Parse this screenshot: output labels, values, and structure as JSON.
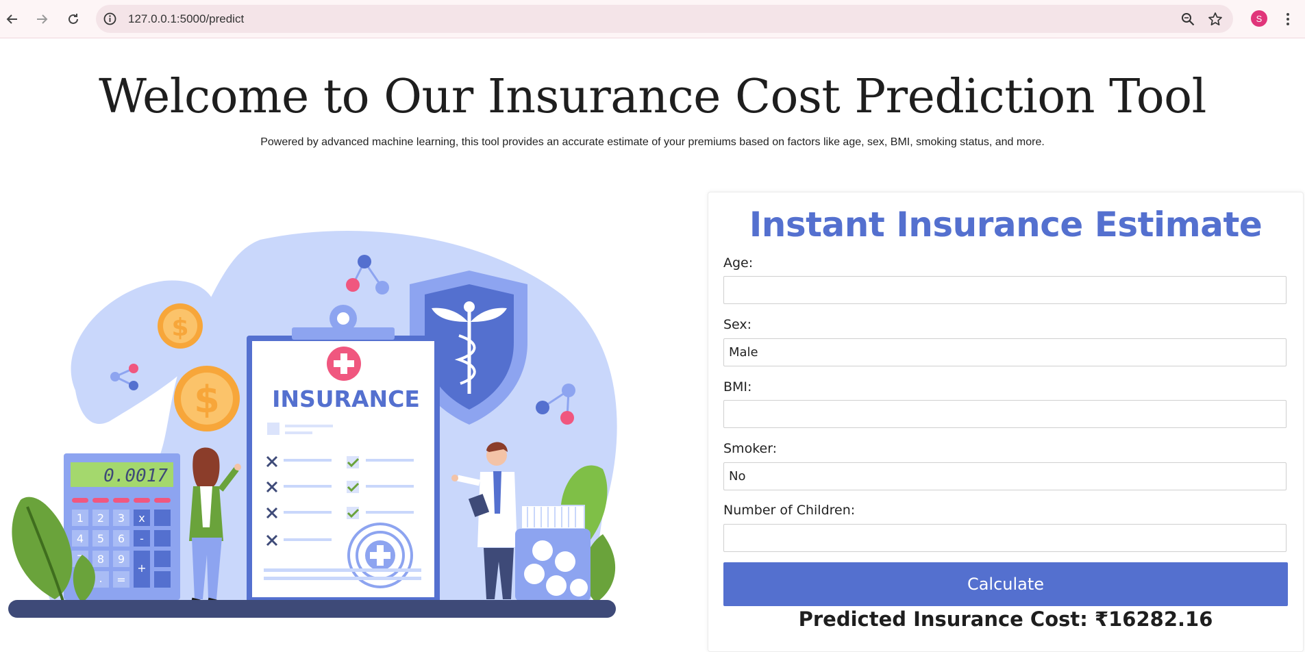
{
  "browser": {
    "url": "127.0.0.1:5000/predict",
    "profile_initial": "S",
    "icons": [
      "back-icon",
      "forward-icon",
      "reload-icon",
      "info-icon",
      "zoom-icon",
      "star-icon",
      "menu-icon"
    ]
  },
  "header": {
    "title": "Welcome to Our Insurance Cost Prediction Tool",
    "subtitle": "Powered by advanced machine learning, this tool provides an accurate estimate of your premiums based on factors like age, sex, BMI, smoking status, and more."
  },
  "illustration": {
    "clipboard_label": "INSURANCE",
    "calculator_display": "0.0017",
    "calculator_keys": [
      "1",
      "2",
      "3",
      "x",
      "4",
      "5",
      "6",
      "-",
      "7",
      "8",
      "9",
      "+",
      ".",
      "="
    ],
    "currency_symbol": "$"
  },
  "form": {
    "title": "Instant Insurance Estimate",
    "fields": [
      {
        "label": "Age:",
        "value": ""
      },
      {
        "label": "Sex:",
        "value": "Male"
      },
      {
        "label": "BMI:",
        "value": ""
      },
      {
        "label": "Smoker:",
        "value": "No"
      },
      {
        "label": "Number of Children:",
        "value": ""
      }
    ],
    "submit_label": "Calculate",
    "result": "Predicted Insurance Cost: ₹16282.16"
  },
  "colors": {
    "accent": "#5470cf",
    "illustration_blob": "#c9d7fb",
    "shield": "#8da4f0",
    "coin": "#f7a63a",
    "leaf": "#6aa33b",
    "pink": "#f0577f",
    "base": "#3e4a78"
  }
}
